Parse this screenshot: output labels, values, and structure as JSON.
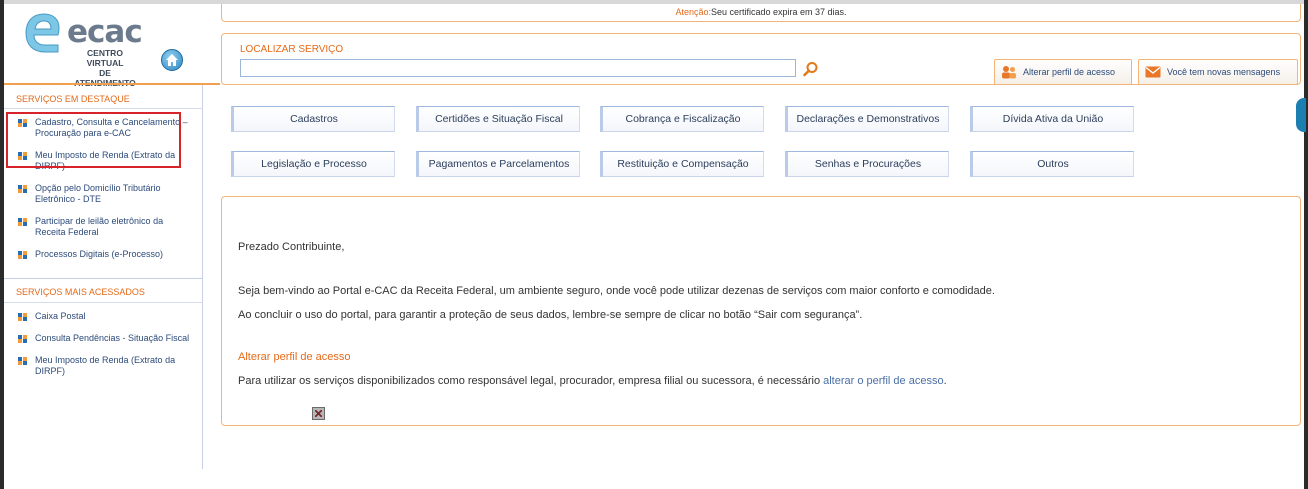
{
  "header": {
    "logo_word": "ecac",
    "logo_sub_line1": "CENTRO VIRTUAL",
    "logo_sub_line2": "DE ATENDIMENTO",
    "alert_label": "Atenção:",
    "alert_text": "Seu certificado expira em 37 dias."
  },
  "search": {
    "title": "LOCALIZAR SERVIÇO",
    "value": "",
    "placeholder": ""
  },
  "top_buttons": {
    "profile": "Alterar perfil de acesso",
    "messages": "Você tem novas mensagens"
  },
  "sidebar": {
    "featured_title": "SERVIÇOS EM DESTAQUE",
    "featured_items": [
      "Cadastro, Consulta e Cancelamento – Procuração para e-CAC",
      "Meu Imposto de Renda (Extrato da DIRPF)",
      "Opção pelo Domicílio Tributário Eletrônico - DTE",
      "Participar de leilão eletrônico da Receita Federal",
      "Processos Digitais (e-Processo)"
    ],
    "most_accessed_title": "SERVIÇOS MAIS ACESSADOS",
    "most_accessed_items": [
      "Caixa Postal",
      "Consulta Pendências - Situação Fiscal",
      "Meu Imposto de Renda (Extrato da DIRPF)"
    ]
  },
  "categories": {
    "row1": [
      "Cadastros",
      "Certidões e Situação Fiscal",
      "Cobrança e Fiscalização",
      "Declarações e Demonstrativos",
      "Dívida Ativa da União"
    ],
    "row2": [
      "Legislação e Processo",
      "Pagamentos e Parcelamentos",
      "Restituição e Compensação",
      "Senhas e Procurações",
      "Outros"
    ]
  },
  "content": {
    "greeting": "Prezado Contribuinte,",
    "p1": "Seja bem-vindo ao Portal e-CAC da Receita Federal, um ambiente seguro, onde você pode utilizar dezenas de serviços com maior conforto e comodidade.",
    "p2": "Ao concluir o uso do portal, para garantir a proteção de seus dados, lembre-se sempre de clicar no botão “Sair com segurança”.",
    "subtitle": "Alterar perfil de acesso",
    "p3_prefix": "Para utilizar os serviços disponibilizados como responsável legal, procurador, empresa filial ou sucessora, é necessário ",
    "p3_link": "alterar o perfil de acesso",
    "p3_suffix": "."
  },
  "colors": {
    "accent_orange": "#e46a1a",
    "link_blue": "#2c4a7a",
    "highlight_red": "#d8232a"
  }
}
